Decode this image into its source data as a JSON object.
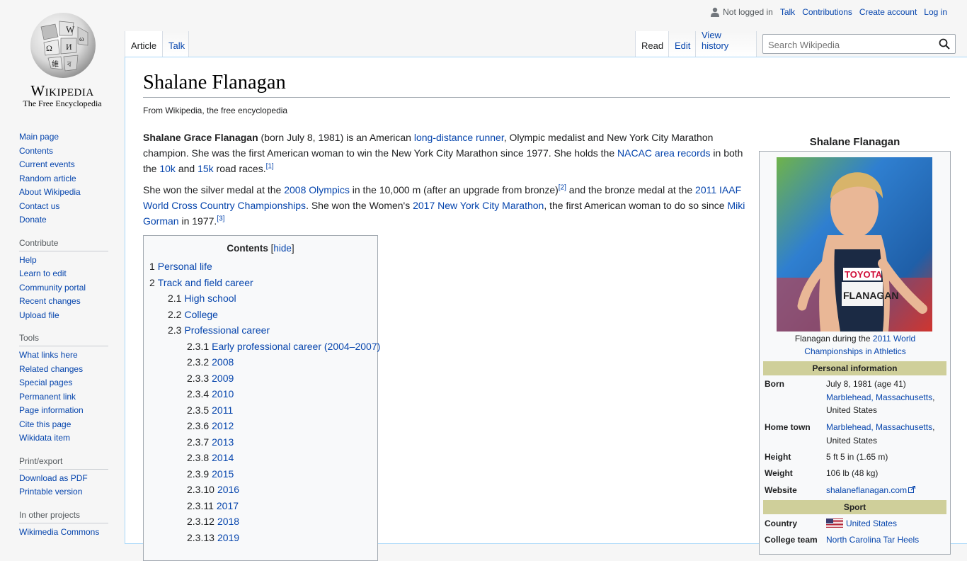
{
  "logo": {
    "wordmark": "Wikipedia",
    "tagline": "The Free Encyclopedia"
  },
  "sidebar": {
    "nav": [
      "Main page",
      "Contents",
      "Current events",
      "Random article",
      "About Wikipedia",
      "Contact us",
      "Donate"
    ],
    "contribute": {
      "heading": "Contribute",
      "items": [
        "Help",
        "Learn to edit",
        "Community portal",
        "Recent changes",
        "Upload file"
      ]
    },
    "tools": {
      "heading": "Tools",
      "items": [
        "What links here",
        "Related changes",
        "Special pages",
        "Permanent link",
        "Page information",
        "Cite this page",
        "Wikidata item"
      ]
    },
    "print": {
      "heading": "Print/export",
      "items": [
        "Download as PDF",
        "Printable version"
      ]
    },
    "projects": {
      "heading": "In other projects",
      "items": [
        "Wikimedia Commons"
      ]
    }
  },
  "personal": {
    "not_logged": "Not logged in",
    "talk": "Talk",
    "contributions": "Contributions",
    "create": "Create account",
    "login": "Log in"
  },
  "tabs": {
    "article": "Article",
    "talk": "Talk",
    "read": "Read",
    "edit": "Edit",
    "history": "View history"
  },
  "search": {
    "placeholder": "Search Wikipedia"
  },
  "page": {
    "title": "Shalane Flanagan",
    "from": "From Wikipedia, the free encyclopedia",
    "p1": {
      "bold": "Shalane Grace Flanagan",
      "t1": " (born July 8, 1981) is an American ",
      "l1": "long-distance runner",
      "t2": ", Olympic medalist and New York City Marathon champion. She was the first American woman to win the New York City Marathon since 1977. She holds the ",
      "l2": "NACAC area records",
      "t3": " in both the ",
      "l3": "10k",
      "t4": " and ",
      "l4": "15k",
      "t5": " road races.",
      "ref": "[1]"
    },
    "p2": {
      "t1": "She won the silver medal at the ",
      "l1": "2008 Olympics",
      "t2": " in the 10,000 m (after an upgrade from bronze)",
      "ref1": "[2]",
      "t3": " and the bronze medal at the ",
      "l2": "2011 IAAF World Cross Country Championships",
      "t4": ". She won the Women's ",
      "l3": "2017 New York City Marathon",
      "t5": ", the first American woman to do so since ",
      "l4": "Miki Gorman",
      "t6": " in 1977.",
      "ref2": "[3]"
    }
  },
  "toc": {
    "title": "Contents",
    "hide": "hide",
    "items": [
      {
        "num": "1",
        "label": "Personal life",
        "level": 1
      },
      {
        "num": "2",
        "label": "Track and field career",
        "level": 1
      },
      {
        "num": "2.1",
        "label": "High school",
        "level": 2
      },
      {
        "num": "2.2",
        "label": "College",
        "level": 2
      },
      {
        "num": "2.3",
        "label": "Professional career",
        "level": 2
      },
      {
        "num": "2.3.1",
        "label": "Early professional career (2004–2007)",
        "level": 3
      },
      {
        "num": "2.3.2",
        "label": "2008",
        "level": 3
      },
      {
        "num": "2.3.3",
        "label": "2009",
        "level": 3
      },
      {
        "num": "2.3.4",
        "label": "2010",
        "level": 3
      },
      {
        "num": "2.3.5",
        "label": "2011",
        "level": 3
      },
      {
        "num": "2.3.6",
        "label": "2012",
        "level": 3
      },
      {
        "num": "2.3.7",
        "label": "2013",
        "level": 3
      },
      {
        "num": "2.3.8",
        "label": "2014",
        "level": 3
      },
      {
        "num": "2.3.9",
        "label": "2015",
        "level": 3
      },
      {
        "num": "2.3.10",
        "label": "2016",
        "level": 3
      },
      {
        "num": "2.3.11",
        "label": "2017",
        "level": 3
      },
      {
        "num": "2.3.12",
        "label": "2018",
        "level": 3
      },
      {
        "num": "2.3.13",
        "label": "2019",
        "level": 3
      }
    ]
  },
  "infobox": {
    "name": "Shalane Flanagan",
    "bib_sponsor": "TOYOTA",
    "bib_name": "FLANAGAN",
    "caption_text": "Flanagan during the ",
    "caption_link": "2011 World Championships in Athletics",
    "personal_header": "Personal information",
    "born_label": "Born",
    "born_date": "July 8, 1981 (age 41)",
    "born_place_link": "Marblehead, Massachusetts",
    "born_country": "United States",
    "hometown_label": "Home town",
    "hometown_link": "Marblehead, Massachusetts",
    "hometown_country": "United States",
    "height_label": "Height",
    "height_value": "5 ft 5 in (1.65 m)",
    "weight_label": "Weight",
    "weight_value": "106 lb (48 kg)",
    "website_label": "Website",
    "website_value": "shalaneflanagan.com",
    "sport_header": "Sport",
    "country_label": "Country",
    "country_value": "United States",
    "college_label": "College team",
    "college_value": "North Carolina Tar Heels"
  },
  "colors": {
    "link": "#0645ad",
    "section_bg": "#cfcf9a",
    "border": "#a2a9b1"
  }
}
